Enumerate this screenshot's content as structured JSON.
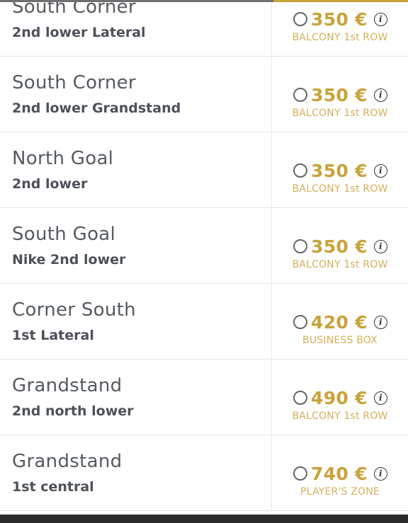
{
  "colors": {
    "accent": "#c9a23a",
    "category": "#d3b059",
    "text": "#555a60",
    "divider": "#e6e6e6",
    "bottom_bar": "#2b2b2b"
  },
  "tickets": [
    {
      "zone": "South Corner",
      "sector": "2nd lower Lateral",
      "price": "350 €",
      "category": "BALCONY 1st ROW"
    },
    {
      "zone": "South Corner",
      "sector": "2nd lower Grandstand",
      "price": "350 €",
      "category": "BALCONY 1st ROW"
    },
    {
      "zone": "North Goal",
      "sector": "2nd lower",
      "price": "350 €",
      "category": "BALCONY 1st ROW"
    },
    {
      "zone": "South Goal",
      "sector": "Nike 2nd lower",
      "price": "350 €",
      "category": "BALCONY 1st ROW"
    },
    {
      "zone": "Corner South",
      "sector": "1st Lateral",
      "price": "420 €",
      "category": "BUSINESS BOX"
    },
    {
      "zone": "Grandstand",
      "sector": "2nd north lower",
      "price": "490 €",
      "category": "BALCONY 1st ROW"
    },
    {
      "zone": "Grandstand",
      "sector": "1st central",
      "price": "740 €",
      "category": "PLAYER'S ZONE"
    }
  ],
  "icons": {
    "radio": "radio-unchecked-icon",
    "info": "info-icon",
    "info_glyph": "i"
  }
}
